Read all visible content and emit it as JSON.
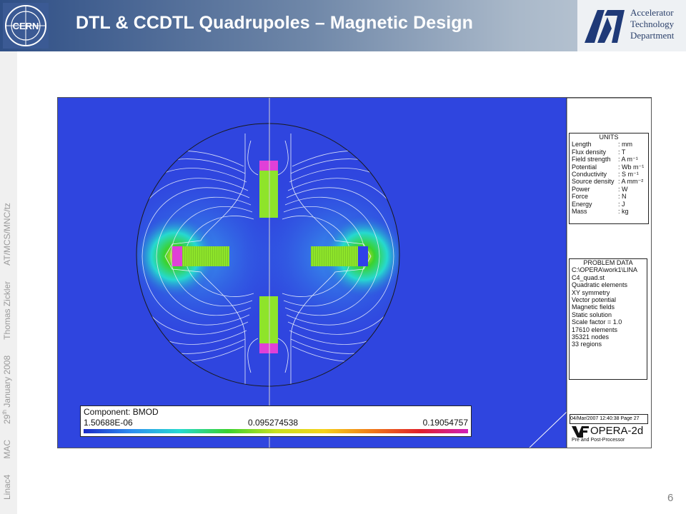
{
  "header": {
    "title": "DTL & CCDTL Quadrupoles – Magnetic Design",
    "cern_logo_text": "CERN",
    "dept_lines": [
      "Accelerator",
      "Technology",
      "Department"
    ],
    "colors": {
      "header_start": "#2f4f86",
      "header_end": "#c4cfda"
    }
  },
  "sidebar": {
    "items": [
      "Linac4",
      "MAC",
      "29",
      "th",
      " January 2008",
      "Thomas Zickler",
      "AT/MCS/MNC/tz"
    ]
  },
  "page_number": "6",
  "simulation": {
    "units": {
      "title": "UNITS",
      "rows": [
        {
          "k": "Length",
          "v": ": mm"
        },
        {
          "k": "Flux density",
          "v": ": T"
        },
        {
          "k": "Field strength",
          "v": ": A m⁻¹"
        },
        {
          "k": "Potential",
          "v": ": Wb m⁻¹"
        },
        {
          "k": "Conductivity",
          "v": ": S m⁻¹"
        },
        {
          "k": "Source density",
          "v": ": A mm⁻²"
        },
        {
          "k": "Power",
          "v": ": W"
        },
        {
          "k": "Force",
          "v": ": N"
        },
        {
          "k": "Energy",
          "v": ": J"
        },
        {
          "k": "Mass",
          "v": ": kg"
        }
      ]
    },
    "problem": {
      "title": "PROBLEM DATA",
      "lines": [
        "C:\\OPERA\\work1\\LINA",
        "C4_quad.st",
        "Quadratic elements",
        "XY symmetry",
        "Vector potential",
        "Magnetic fields",
        "Static solution",
        "Scale factor = 1.0",
        "17610 elements",
        "35321 nodes",
        "33 regions"
      ]
    },
    "timestamp": "04/Mar/2007 12:40:38 Page 27",
    "software": {
      "name": "OPERA-2d",
      "subtitle": "Pre and Post-Processor"
    },
    "legend": {
      "component": "Component: BMOD",
      "min": "1.50688E-06",
      "mid": "0.095274538",
      "max": "0.19054757",
      "gradient": [
        "#1a2cc8",
        "#2f8ff0",
        "#26d9d0",
        "#3ad22e",
        "#c8e020",
        "#f5d21a",
        "#f07a18",
        "#e0202a",
        "#d020b8"
      ]
    },
    "colors": {
      "field_low": "#2f45df",
      "iron": "#8ee42a",
      "coil_pink": "#e040d8",
      "coil_blue": "#3040e8"
    }
  }
}
